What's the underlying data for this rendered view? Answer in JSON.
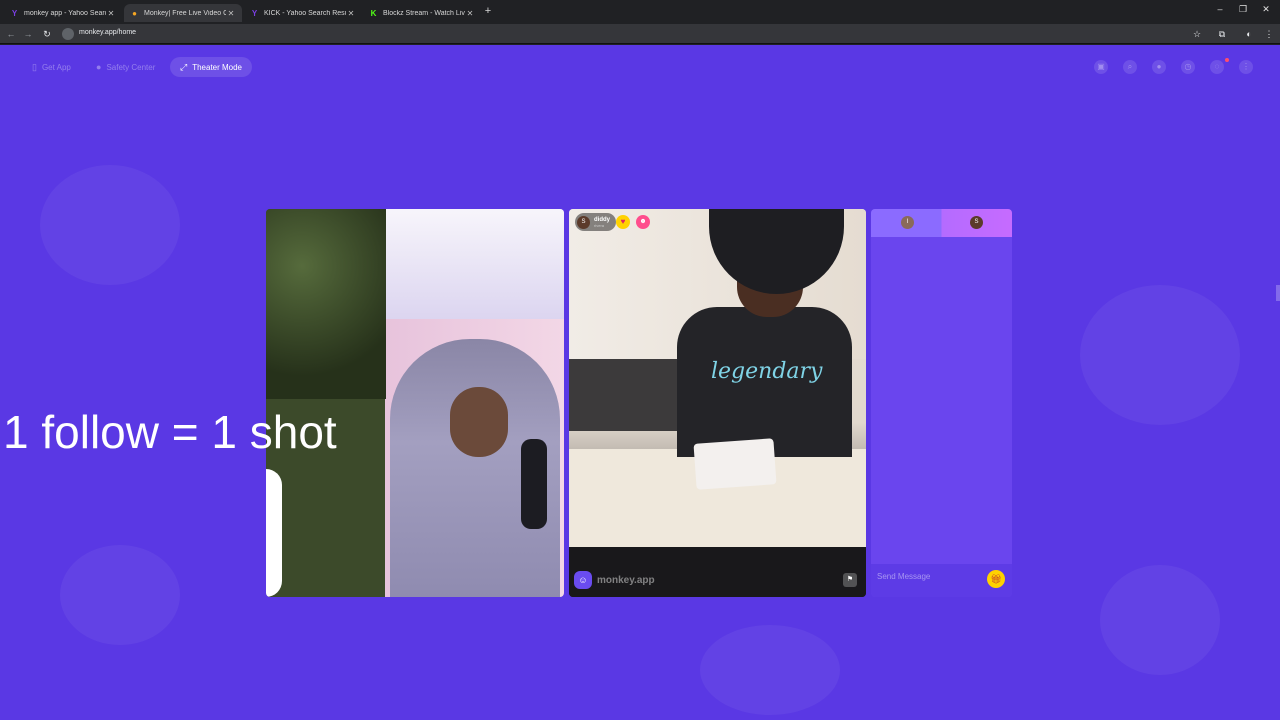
{
  "browser": {
    "tabs": [
      {
        "title": "monkey app - Yahoo Search Re",
        "icon": "yahoo-icon",
        "active": false
      },
      {
        "title": "Monkey| Free Live Video Ch",
        "icon": "monkey-icon",
        "active": true
      },
      {
        "title": "KICK - Yahoo Search Results",
        "icon": "yahoo-icon",
        "active": false
      },
      {
        "title": "Blockz Stream - Watch Live on",
        "icon": "kick-icon",
        "active": false
      }
    ],
    "url": "monkey.app/home",
    "colors": {
      "chrome": "#202124",
      "toolbar": "#35363a"
    }
  },
  "nav": {
    "get_app": "Get App",
    "safety_center": "Safety Center",
    "theater_mode": "Theater Mode",
    "right_icons": [
      "shop-icon",
      "search-icon",
      "profile-icon",
      "history-icon",
      "chat-icon",
      "menu-icon"
    ]
  },
  "remote": {
    "username": "diddy",
    "sub": "rivera",
    "avatar_letter": "S"
  },
  "watermark": "monkey.app",
  "chat": {
    "placeholder": "Send Message",
    "left_avatar": "I",
    "right_avatar": "S"
  },
  "overlay": "1 follow = 1 shot",
  "colors": {
    "page_bg": "#5a38e4",
    "chat_bg": "#6a45ee",
    "accent_yellow": "#ffd200"
  }
}
